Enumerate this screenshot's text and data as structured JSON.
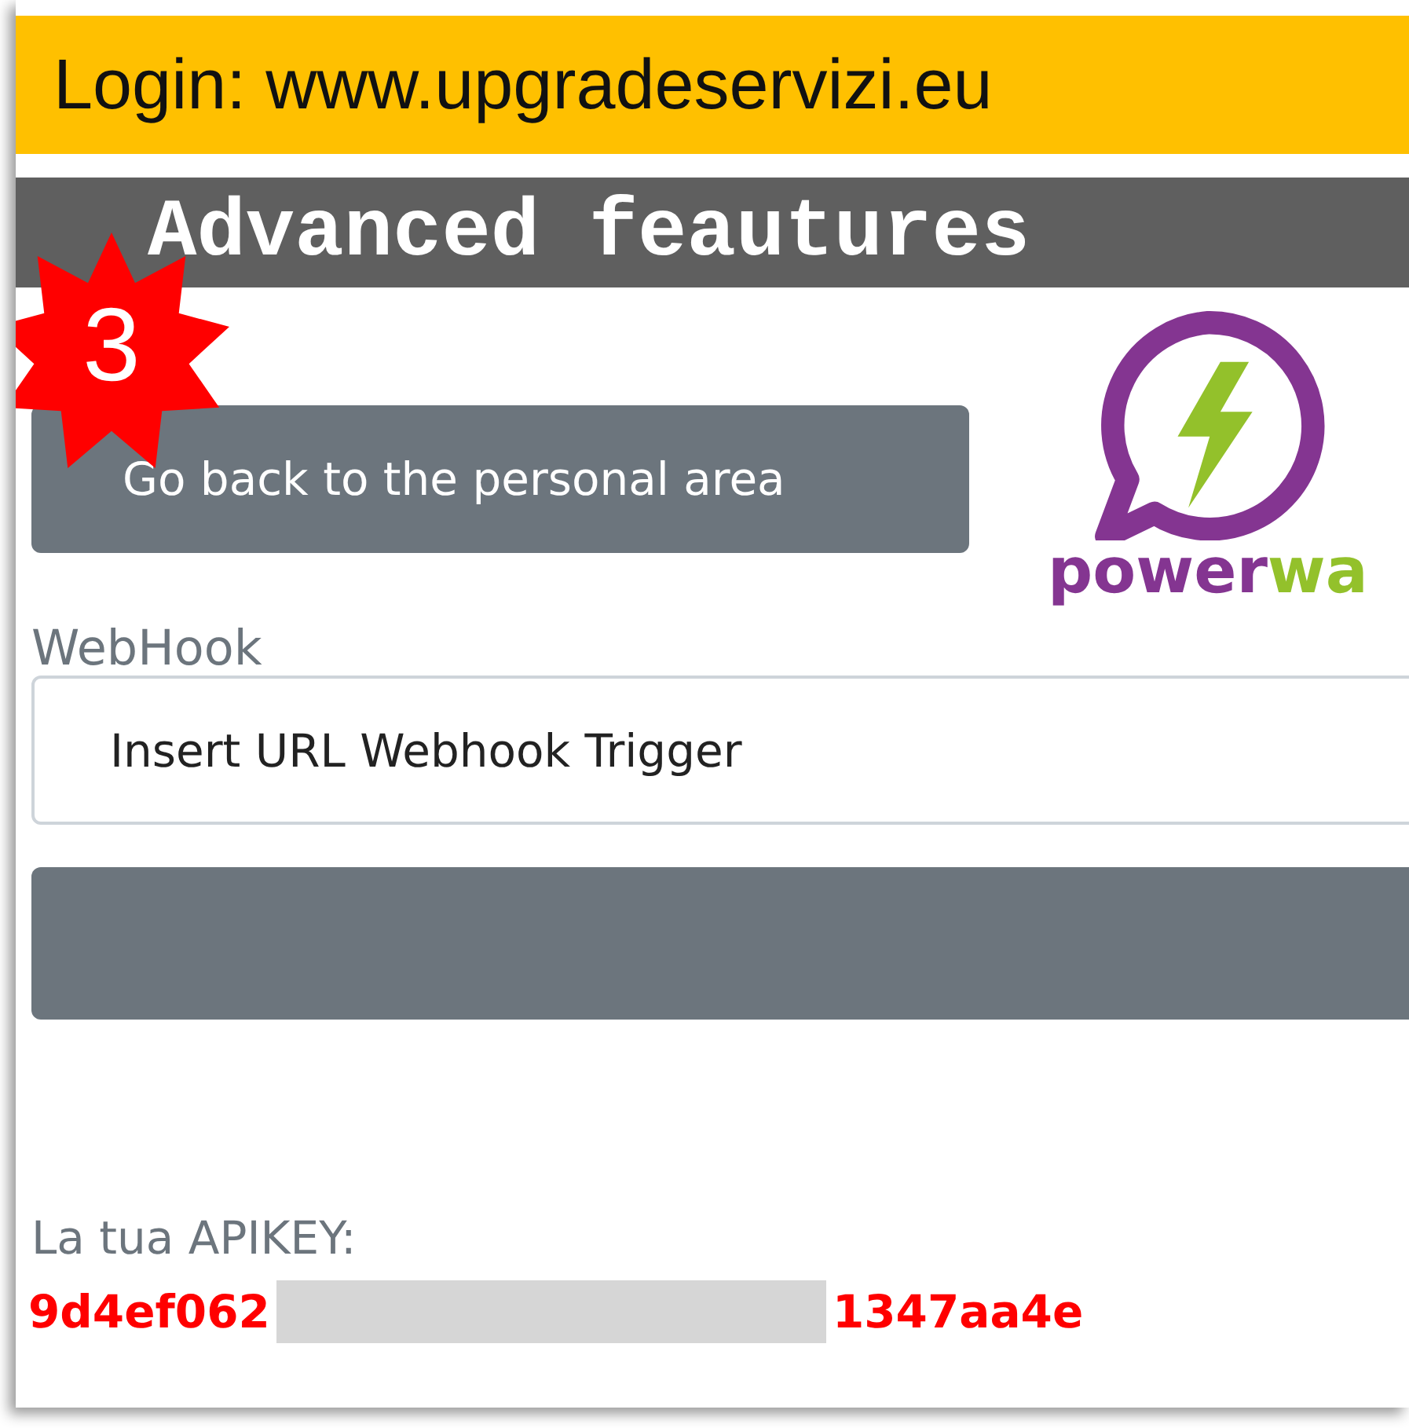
{
  "header": {
    "title": "Login: www.upgradeservizi.eu"
  },
  "section": {
    "title": "Advanced feautures"
  },
  "step_badge": {
    "label": "3"
  },
  "back_button": {
    "label": "Go back to the personal area"
  },
  "logo": {
    "word_start": "power",
    "word_end": "wa"
  },
  "webhook": {
    "label": "WebHook",
    "placeholder": "Insert URL Webhook Trigger"
  },
  "apikey": {
    "label": "La tua APIKEY:",
    "start": "9d4ef062",
    "end": "1347aa4e"
  }
}
